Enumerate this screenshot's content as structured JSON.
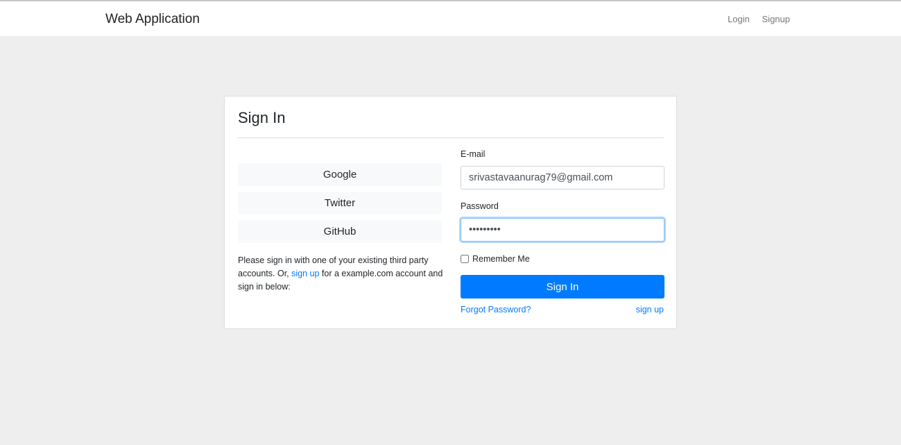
{
  "nav": {
    "brand": "Web Application",
    "links": [
      "Login",
      "Signup"
    ]
  },
  "card": {
    "title": "Sign In",
    "social": [
      "Google",
      "Twitter",
      "GitHub"
    ],
    "help": {
      "before": "Please sign in with one of your existing third party accounts. Or, ",
      "link": "sign up",
      "after": " for a example.com account and sign in below:"
    },
    "email_label": "E-mail",
    "email_value": "srivastavaanurag79@gmail.com",
    "password_label": "Password",
    "password_value": "abcdefghi",
    "remember": "Remember Me",
    "submit": "Sign In",
    "forgot": "Forgot Password?",
    "signup": "sign up"
  },
  "colors": {
    "primary": "#007bff",
    "background": "#eeeeee"
  }
}
